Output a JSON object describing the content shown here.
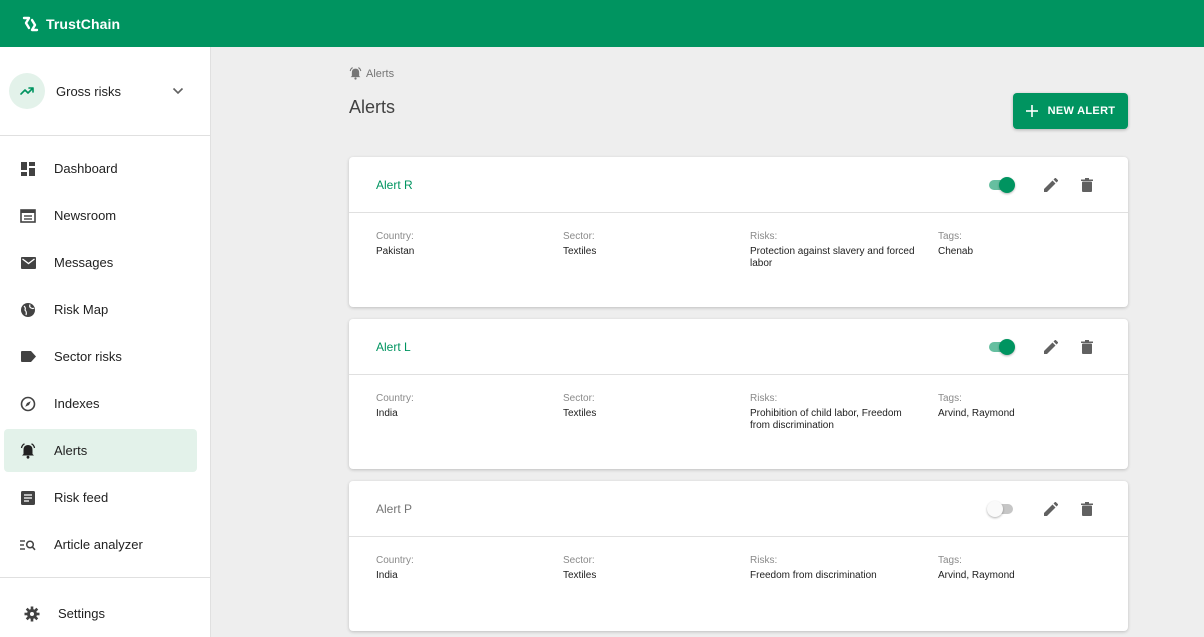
{
  "app": {
    "name": "TrustChain"
  },
  "scope": {
    "label": "Gross risks"
  },
  "sidebar": {
    "items": [
      {
        "label": "Dashboard",
        "icon": "dashboard-icon"
      },
      {
        "label": "Newsroom",
        "icon": "newsroom-icon"
      },
      {
        "label": "Messages",
        "icon": "mail-icon"
      },
      {
        "label": "Risk Map",
        "icon": "globe-icon"
      },
      {
        "label": "Sector risks",
        "icon": "label-icon"
      },
      {
        "label": "Indexes",
        "icon": "compass-icon"
      },
      {
        "label": "Alerts",
        "icon": "alarm-icon",
        "active": true
      },
      {
        "label": "Risk feed",
        "icon": "article-icon"
      },
      {
        "label": "Article analyzer",
        "icon": "manage-search-icon"
      }
    ],
    "settings": {
      "label": "Settings",
      "icon": "gear-icon"
    }
  },
  "breadcrumb": {
    "label": "Alerts"
  },
  "page": {
    "title": "Alerts",
    "new_alert_label": "NEW ALERT"
  },
  "field_labels": {
    "country": "Country:",
    "sector": "Sector:",
    "risks": "Risks:",
    "tags": "Tags:"
  },
  "alerts": [
    {
      "name": "Alert R",
      "enabled": true,
      "country": "Pakistan",
      "sector": "Textiles",
      "risks": "Protection against slavery and forced labor",
      "tags": "Chenab"
    },
    {
      "name": "Alert L",
      "enabled": true,
      "country": "India",
      "sector": "Textiles",
      "risks": "Prohibition of child labor, Freedom from discrimination",
      "tags": "Arvind, Raymond"
    },
    {
      "name": "Alert P",
      "enabled": false,
      "country": "India",
      "sector": "Textiles",
      "risks": "Freedom from discrimination",
      "tags": "Arvind, Raymond"
    }
  ],
  "colors": {
    "brand": "#009460",
    "active_bg": "#e3f2ea",
    "background": "#eeeeee"
  }
}
